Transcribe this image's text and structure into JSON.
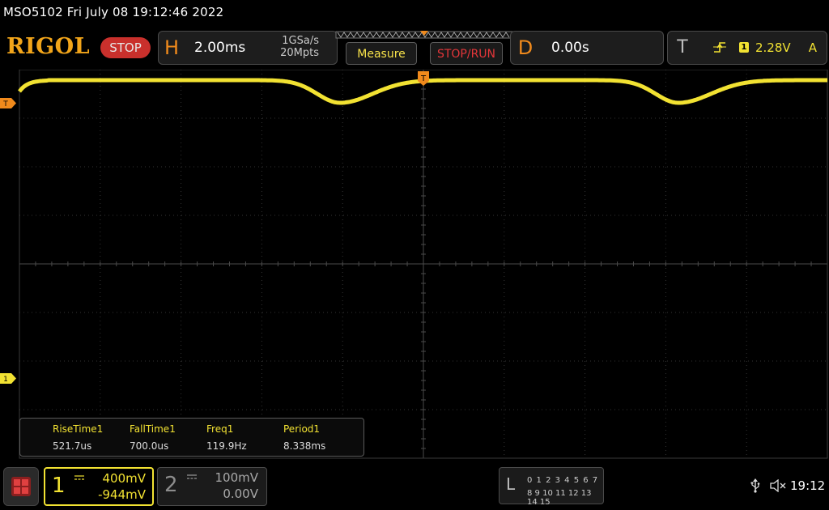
{
  "status": {
    "text": "MSO5102  Fri July 08 19:12:46 2022"
  },
  "toolbar": {
    "logo": "RIGOL",
    "run_state": "STOP",
    "horizontal": {
      "letter": "H",
      "timebase": "2.00ms",
      "sample_rate": "1GSa/s",
      "mem_depth": "20Mpts"
    },
    "measure_label": "Measure",
    "stop_run_label": "STOP/RUN",
    "delay": {
      "letter": "D",
      "value": "0.00s"
    },
    "trigger": {
      "letter": "T",
      "source": "1",
      "level": "2.28V",
      "mode": "A",
      "edge_icon": "rising-edge-icon"
    }
  },
  "markers": {
    "ch1": "1",
    "trigger": "T"
  },
  "measurements": [
    {
      "name": "RiseTime1",
      "value": "521.7us"
    },
    {
      "name": "FallTime1",
      "value": "700.0us"
    },
    {
      "name": "Freq1",
      "value": "119.9Hz"
    },
    {
      "name": "Period1",
      "value": "8.338ms"
    }
  ],
  "channels": [
    {
      "num": "1",
      "scale": "400mV",
      "offset": "-944mV",
      "color": "#f2e232"
    },
    {
      "num": "2",
      "scale": "100mV",
      "offset": "0.00V",
      "color": "#9a9a9a"
    }
  ],
  "la": {
    "letter": "L",
    "row1": "0 1 2 3  4 5 6 7",
    "row2": "8 9 10 11  12 13 14 15"
  },
  "system": {
    "clock": "19:12"
  },
  "colors": {
    "trace": "#f2e232",
    "accent": "#f08a1c",
    "stop": "#c9302c"
  }
}
